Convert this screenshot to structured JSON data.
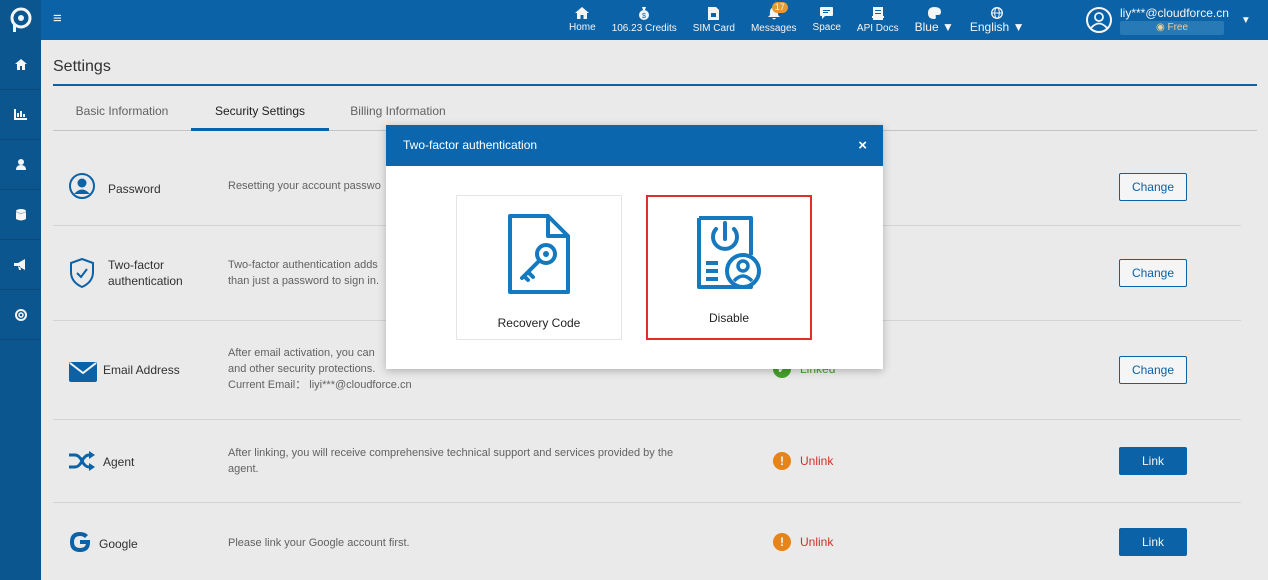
{
  "topbar": {
    "nav": [
      {
        "label": "Home",
        "icon": "home-icon"
      },
      {
        "label": "106.23 Credits",
        "icon": "credits-icon"
      },
      {
        "label": "SIM Card",
        "icon": "sim-card-icon"
      },
      {
        "label": "Messages",
        "icon": "bell-icon",
        "badge": "17"
      },
      {
        "label": "Space",
        "icon": "chat-icon"
      },
      {
        "label": "API Docs",
        "icon": "docs-icon"
      },
      {
        "label": "Blue",
        "icon": "palette-icon"
      },
      {
        "label": "English",
        "icon": "globe-icon"
      }
    ],
    "user": {
      "email": "liy***@cloudforce.cn",
      "plan": "Free"
    }
  },
  "page": {
    "title": "Settings",
    "tabs": [
      "Basic Information",
      "Security Settings",
      "Billing Information"
    ],
    "active_tab": "Security Settings"
  },
  "rows": [
    {
      "name": "Password",
      "desc": "Resetting your account passwo",
      "button": "Change"
    },
    {
      "name_line1": "Two-factor",
      "name_line2": "authentication",
      "desc_line1": "Two-factor authentication adds",
      "desc_line2": "than just a password to sign in.",
      "button": "Change"
    },
    {
      "name": "Email Address",
      "desc_line1": "After email activation, you can",
      "desc_line2": "and other security protections.",
      "desc_line3": "Current Email： liyi***@cloudforce.cn",
      "status": "Linked",
      "button": "Change"
    },
    {
      "name": "Agent",
      "desc_line1": "After linking, you will receive comprehensive technical support and services provided by the",
      "desc_line2": "agent.",
      "status": "Unlink",
      "button": "Link"
    },
    {
      "name": "Google",
      "desc": "Please link your Google account first.",
      "status": "Unlink",
      "button": "Link"
    }
  ],
  "modal": {
    "title": "Two-factor authentication",
    "close": "×",
    "options": [
      "Recovery Code",
      "Disable"
    ]
  },
  "colors": {
    "primary": "#0c66ad",
    "sidebar": "#0c5a94",
    "linked": "#49a92c",
    "unlink": "#d9322c",
    "warn": "#f08a1c",
    "selected_border": "#d9322c"
  }
}
